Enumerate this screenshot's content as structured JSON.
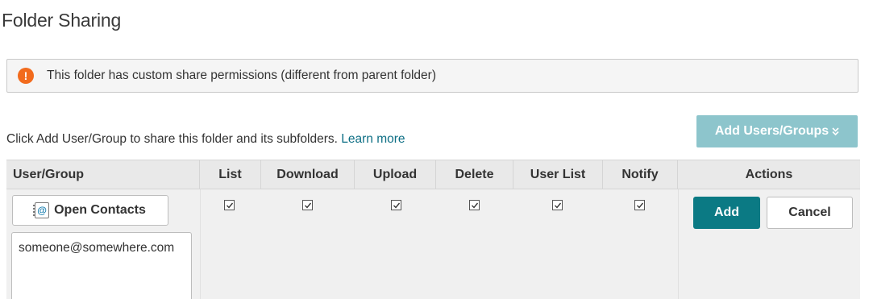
{
  "page": {
    "title": "Folder Sharing"
  },
  "alert": {
    "icon": "exclamation-icon",
    "icon_glyph": "!",
    "text": "This folder has custom share permissions (different from parent folder)",
    "icon_color": "#f26b1d"
  },
  "instructions": {
    "text": "Click Add User/Group to share this folder and its subfolders.",
    "link": "Learn more"
  },
  "add_users_button": {
    "label": "Add Users/Groups",
    "chevron": "»",
    "color": "#8dc5cc"
  },
  "table": {
    "headers": [
      "User/Group",
      "List",
      "Download",
      "Upload",
      "Delete",
      "User List",
      "Notify",
      "Actions"
    ],
    "row": {
      "open_contacts_label": "Open Contacts",
      "contacts_icon_glyph": "@",
      "user_value": "someone@somewhere.com",
      "permissions": {
        "list": true,
        "download": true,
        "upload": true,
        "delete": true,
        "user_list": true,
        "notify": true
      },
      "add_label": "Add",
      "cancel_label": "Cancel"
    }
  },
  "colors": {
    "primary": "#0b7a84",
    "link": "#0e6f85"
  }
}
